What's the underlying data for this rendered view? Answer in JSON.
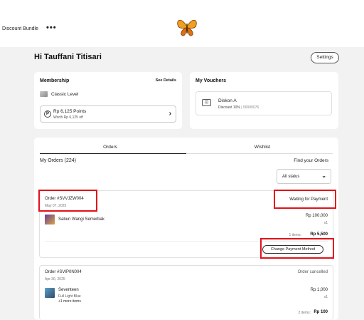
{
  "header": {
    "nav_link": "Discount Bundle",
    "more_icon": "more-horizontal-icon",
    "logo": "butterfly-logo"
  },
  "greeting": "Hi Tauffani Titisari",
  "settings_label": "Settings",
  "membership": {
    "title": "Membership",
    "see_details": "See Details",
    "level": "Classic Level",
    "points": "Rp 6,125 Points",
    "worth": "Worth Rp 6,125 off"
  },
  "vouchers": {
    "title": "My Vouchers",
    "item_title": "Diskon A",
    "item_discount": "Discount 10%",
    "item_code": "| 50000076"
  },
  "tabs": [
    {
      "label": "Orders",
      "active": true
    },
    {
      "label": "Wishlist",
      "active": false
    }
  ],
  "orders_section": {
    "title": "My Orders (224)",
    "find": "Find your Orders",
    "status_filter": "All status"
  },
  "orders": [
    {
      "id": "Order #SVVJZW004",
      "date": "May 07, 2025",
      "status": "Waiting for Payment",
      "product": "Sabun Wangi Semerbak",
      "price": "Rp 100,000",
      "qty": "x1",
      "items_label": "1 items:",
      "total": "Rp 5,500",
      "action": "Change Payment Method"
    },
    {
      "id": "Order #SVIP0N004",
      "date": "Apr 30, 2025",
      "status": "Order cancelled",
      "product": "Seventeen",
      "variant": "Full Light Blue",
      "more": "+1 more items",
      "price": "Rp 1,000",
      "qty": "x1",
      "items_label": "2 items:",
      "total": "Rp 100"
    }
  ],
  "colors": {
    "highlight": "#e0131a",
    "background": "#f2f2f2",
    "card": "#ffffff"
  }
}
